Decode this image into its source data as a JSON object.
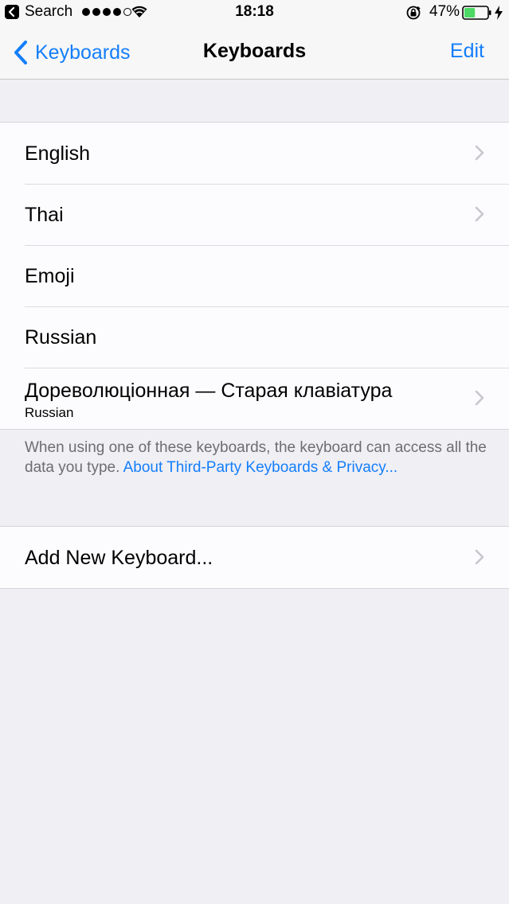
{
  "status_bar": {
    "back_app": "Search",
    "time": "18:18",
    "battery_percent": "47%",
    "battery_level": 0.47,
    "signal_bars_filled": 4,
    "signal_bars_total": 5
  },
  "nav": {
    "back_label": "Keyboards",
    "title": "Keyboards",
    "edit_label": "Edit"
  },
  "keyboards": [
    {
      "label": "English",
      "subtitle": "",
      "chevron": true
    },
    {
      "label": "Thai",
      "subtitle": "",
      "chevron": true
    },
    {
      "label": "Emoji",
      "subtitle": "",
      "chevron": false
    },
    {
      "label": "Russian",
      "subtitle": "",
      "chevron": false
    },
    {
      "label": "Дореволюцiонная  — Старая клавiатура",
      "subtitle": "Russian",
      "chevron": true
    }
  ],
  "footer": {
    "text": "When using one of these keyboards, the keyboard can access all the data you type. ",
    "link": "About Third-Party Keyboards & Privacy..."
  },
  "add_keyboard": {
    "label": "Add New Keyboard..."
  },
  "colors": {
    "accent": "#147efb",
    "background": "#efeff4",
    "battery": "#4cd964"
  }
}
